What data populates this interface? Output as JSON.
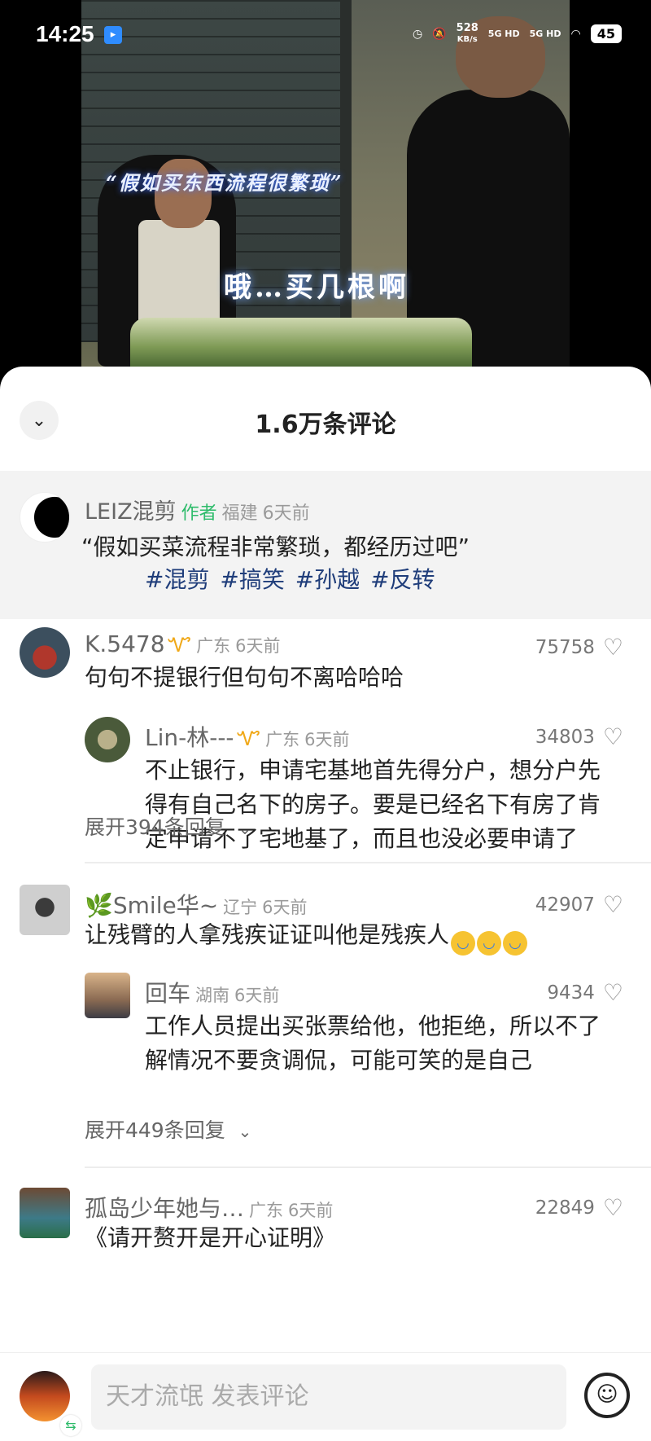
{
  "status_bar": {
    "time": "14:25",
    "net_speed_value": "528",
    "net_speed_unit": "KB/s",
    "signal1": "5G HD",
    "signal2": "5G HD",
    "battery": "45"
  },
  "video": {
    "caption_top": "“假如买东西流程很繁琐”",
    "caption_sub": "哦…买几根啊"
  },
  "sheet": {
    "title": "1.6万条评论",
    "author_post": {
      "name": "LEIZ混剪",
      "tag": "作者",
      "location": "福建",
      "time": "6天前",
      "text": "“假如买菜流程非常繁琐，都经历过吧”",
      "hashtags": "#混剪 #搞笑 #孙越 #反转"
    },
    "comments": [
      {
        "name": "K.5478",
        "location": "广东",
        "time": "6天前",
        "likes": "75758",
        "text": "句句不提银行但句句不离哈哈哈",
        "reply": {
          "name": "Lin-林---",
          "location": "广东",
          "time": "6天前",
          "likes": "34803",
          "text_line1": "不止银行，申请宅基地首先得分户，想分户先",
          "text_line2": "得有自己名下的房子。要是已经名下有房了肯",
          "text_line3": "定申请不了宅地基了，而且也没必要申请了"
        },
        "expand": "展开394条回复"
      },
      {
        "name": "🌿Smile华~",
        "location": "辽宁",
        "time": "6天前",
        "likes": "42907",
        "text": "让残臂的人拿残疾证证叫他是残疾人",
        "reply": {
          "name": "回车",
          "location": "湖南",
          "time": "6天前",
          "likes": "9434",
          "text_line1": "工作人员提出买张票给他，他拒绝，所以不了",
          "text_line2": "解情况不要贪调侃，可能可笑的是自己"
        },
        "expand": "展开449条回复"
      },
      {
        "name": "孤岛少年她与…",
        "location": "广东",
        "time": "6天前",
        "likes": "22849",
        "text": "《请开赘开是开心证明》"
      }
    ]
  },
  "bottom_bar": {
    "input_placeholder": "天才流氓 发表评论"
  },
  "colors": {
    "author_tag": "#2dbb6a",
    "hashtag": "#1f3d7a",
    "vip_badge": "#f0a818"
  }
}
